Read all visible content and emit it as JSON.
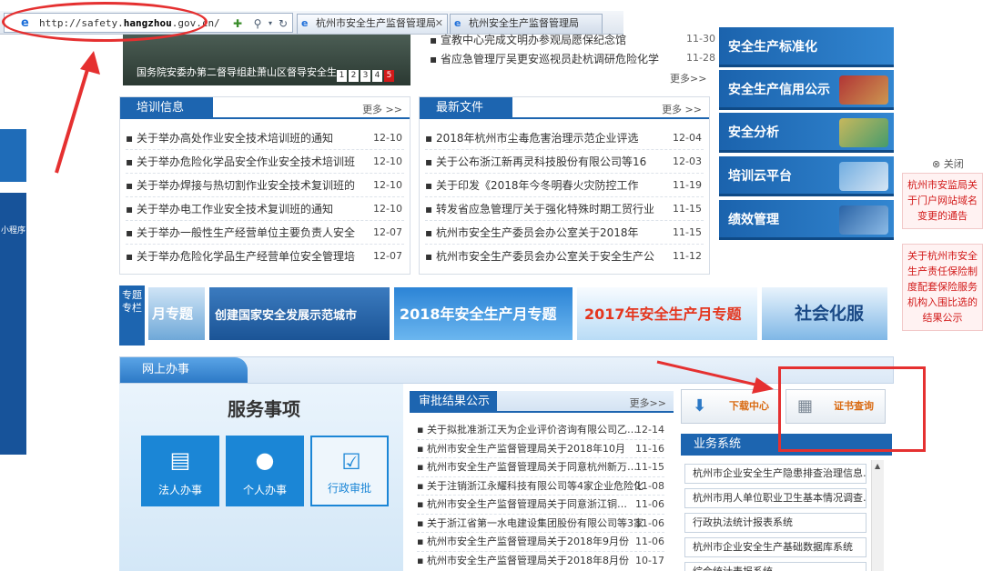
{
  "browser": {
    "url_prefix": "http://safety.",
    "url_bold": "hangzhou",
    "url_suffix": ".gov.cn/",
    "tabs": [
      {
        "label": "杭州市安全生产监督管理局"
      },
      {
        "label": "杭州安全生产监督管理局"
      }
    ]
  },
  "banner": {
    "caption": "国务院安委办第二督导组赴萧山区督导安全生",
    "pages": [
      "1",
      "2",
      "3",
      "4",
      "5"
    ],
    "active_page": 5
  },
  "top_news": {
    "items": [
      {
        "title": "宣教中心完成文明办参观局愿保纪念馆",
        "date": "11-30"
      },
      {
        "title": "省应急管理厅吴更安巡视员赴杭调研危险化学",
        "date": "11-28"
      }
    ],
    "more": "更多>>"
  },
  "right_tiles": [
    {
      "label": "安全生产标准化"
    },
    {
      "label": "安全生产信用公示"
    },
    {
      "label": "安全分析"
    },
    {
      "label": "培训云平台"
    },
    {
      "label": "绩效管理"
    }
  ],
  "training": {
    "title": "培训信息",
    "more": "更多 >>",
    "items": [
      {
        "title": "关于举办高处作业安全技术培训班的通知",
        "date": "12-10"
      },
      {
        "title": "关于举办危险化学品安全作业安全技术培训班",
        "date": "12-10"
      },
      {
        "title": "关于举办焊接与热切割作业安全技术复训班的",
        "date": "12-10"
      },
      {
        "title": "关于举办电工作业安全技术复训班的通知",
        "date": "12-10"
      },
      {
        "title": "关于举办一般性生产经营单位主要负责人安全",
        "date": "12-07"
      },
      {
        "title": "关于举办危险化学品生产经营单位安全管理培",
        "date": "12-07"
      }
    ]
  },
  "documents": {
    "title": "最新文件",
    "more": "更多 >>",
    "items": [
      {
        "title": "2018年杭州市尘毒危害治理示范企业评选",
        "date": "12-04"
      },
      {
        "title": "关于公布浙江新再灵科技股份有限公司等16",
        "date": "12-03"
      },
      {
        "title": "关于印发《2018年今冬明春火灾防控工作",
        "date": "11-19"
      },
      {
        "title": "转发省应急管理厅关于强化特殊时期工贸行业",
        "date": "11-15"
      },
      {
        "title": "杭州市安全生产委员会办公室关于2018年",
        "date": "11-15"
      },
      {
        "title": "杭州市安全生产委员会办公室关于安全生产公",
        "date": "11-12"
      }
    ]
  },
  "topics": {
    "label": "专题专栏",
    "items": [
      {
        "text": "月专题"
      },
      {
        "text": "创建国家安全发展示范城市"
      },
      {
        "text": "2018年安全生产月专题"
      },
      {
        "text": "2017年安全生产月专题"
      },
      {
        "text": "社会化服"
      }
    ]
  },
  "online": {
    "title": "网上办事",
    "service_title": "服务事项",
    "buttons": [
      {
        "label": "法人办事"
      },
      {
        "label": "个人办事"
      },
      {
        "label": "行政审批"
      }
    ]
  },
  "approval": {
    "title": "审批结果公示",
    "more": "更多>>",
    "items": [
      {
        "title": "关于拟批准浙江天为企业评价咨询有限公司乙…",
        "date": "12-14"
      },
      {
        "title": "杭州市安全生产监督管理局关于2018年10月",
        "date": "11-16"
      },
      {
        "title": "杭州市安全生产监督管理局关于同意杭州新万…",
        "date": "11-15"
      },
      {
        "title": "关于注销浙江永耀科技有限公司等4家企业危险化",
        "date": "11-08"
      },
      {
        "title": "杭州市安全生产监督管理局关于同意浙江铜…",
        "date": "11-06"
      },
      {
        "title": "关于浙江省第一水电建设集团股份有限公司等3家",
        "date": "11-06"
      },
      {
        "title": "杭州市安全生产监督管理局关于2018年9月份",
        "date": "11-06"
      },
      {
        "title": "杭州市安全生产监督管理局关于2018年8月份",
        "date": "10-17"
      }
    ]
  },
  "quick": {
    "download": "下载中心",
    "certificate": "证书查询"
  },
  "business": {
    "title": "业务系统",
    "items": [
      {
        "label": "杭州市企业安全生产隐患排查治理信息…"
      },
      {
        "label": "杭州市用人单位职业卫生基本情况调查…"
      },
      {
        "label": "行政执法统计报表系统"
      },
      {
        "label": "杭州市企业安全生产基础数据库系统"
      },
      {
        "label": "综合统计表报系统"
      }
    ]
  },
  "notices": {
    "close": "⊗ 关闭",
    "items": [
      {
        "text": "杭州市安监局关于门户网站域名变更的通告"
      },
      {
        "text": "关于杭州市安全生产责任保险制度配套保险服务机构入围比选的结果公示"
      }
    ]
  },
  "left_panel": {
    "label": "小程序"
  }
}
